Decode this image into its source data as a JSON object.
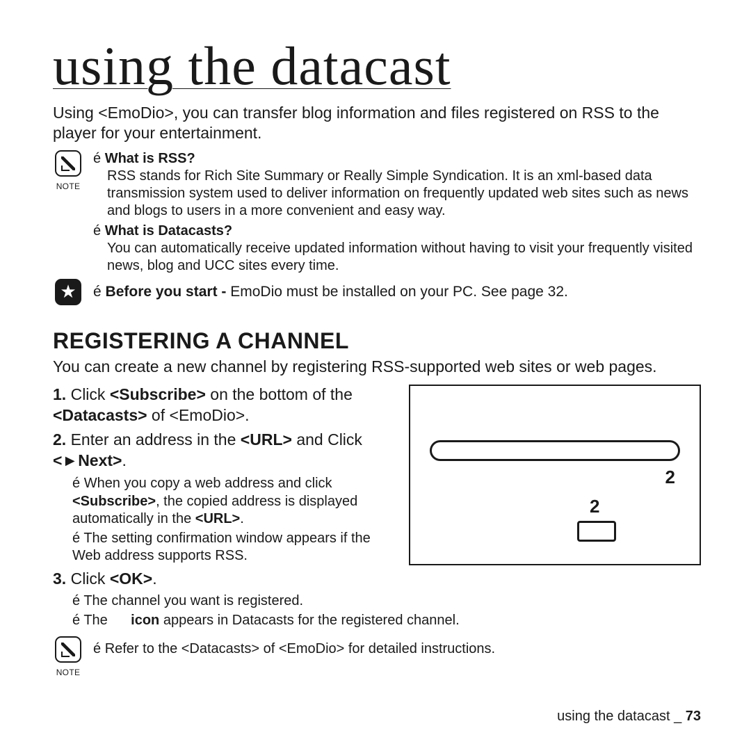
{
  "title": "using the datacast",
  "intro": "Using <EmoDio>, you can transfer blog information and files registered on RSS to the player for your entertainment.",
  "noteLabel": "NOTE",
  "bullet": "é",
  "qa1_title": "What is RSS?",
  "qa1_text": "RSS stands for Rich Site Summary or Really Simple Syndication. It is an xml-based data transmission system used to deliver information on frequently updated web sites such as news and blogs to users in a more convenient and easy way.",
  "qa2_title": "What is Datacasts?",
  "qa2_text": "You can automatically receive updated information without having to visit your frequently visited news, blog and UCC sites every time.",
  "before_bold": "Before you start - ",
  "before_rest": "EmoDio must be installed on your PC. See page 32.",
  "section_h": "REGISTERING A CHANNEL",
  "section_intro": "You can create a new channel by registering RSS-supported web sites or web pages.",
  "step1_a": "1.",
  "step1_b": " Click ",
  "step1_c": "<Subscribe>",
  "step1_d": " on the bottom of the ",
  "step1_e": "<Datacasts>",
  "step1_f": " of <EmoDio>.",
  "step2_a": "2.",
  "step2_b": " Enter an address in the ",
  "step2_c": "<URL>",
  "step2_d": " and Click ",
  "step2_e": "<►Next>",
  "step2_f": ".",
  "sub2a_a": "When you copy a web address and click ",
  "sub2a_b": "<Subscribe>",
  "sub2a_c": ", the copied address is displayed automatically in the ",
  "sub2a_d": "<URL>",
  "sub2a_e": ".",
  "sub2b": "The setting confirmation window appears if the Web address supports RSS.",
  "step3_a": "3.",
  "step3_b": " Click ",
  "step3_c": "<OK>",
  "step3_d": ".",
  "sub3a": "The channel you want is registered.",
  "sub3b_a": "The ",
  "sub3b_b": "icon",
  "sub3b_c": " appears in Datacasts for the registered channel.",
  "end_note": "Refer to the <Datacasts> of <EmoDio> for detailed instructions.",
  "footer_section": "using the datacast _ ",
  "footer_page": "73",
  "fig_n1": "2",
  "fig_n2": "2"
}
